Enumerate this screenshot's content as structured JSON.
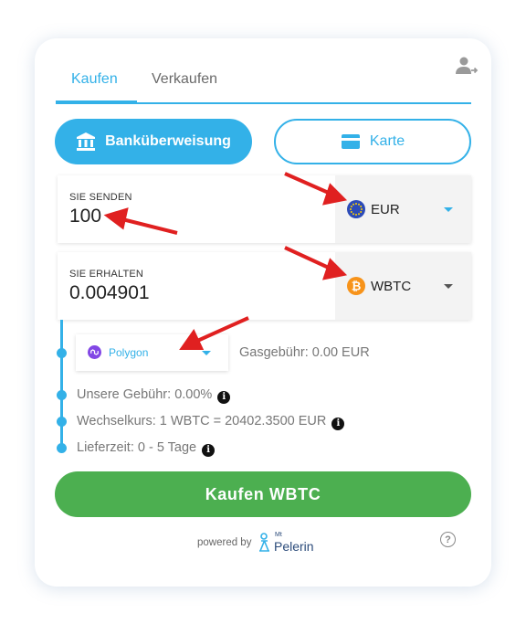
{
  "tabs": {
    "buy": "Kaufen",
    "sell": "Verkaufen"
  },
  "payment": {
    "bank_label": "Banküberweisung",
    "card_label": "Karte"
  },
  "send": {
    "label": "SIE SENDEN",
    "amount": "100",
    "currency": "EUR"
  },
  "receive": {
    "label": "SIE ERHALTEN",
    "amount": "0.004901",
    "currency": "WBTC",
    "currency_symbol": "₿"
  },
  "network": {
    "label": "Polygon",
    "gas_fee": "Gasgebühr: 0.00 EUR"
  },
  "details": {
    "fee": "Unsere Gebühr: 0.00%",
    "rate": "Wechselkurs: 1 WBTC = 20402.3500 EUR",
    "delivery": "Lieferzeit: 0 - 5 Tage",
    "info_glyph": "i"
  },
  "buy_button": "Kaufen WBTC",
  "footer": {
    "powered_by": "powered by",
    "logo_small": "Mt",
    "logo_name": "Pelerin",
    "help_glyph": "?"
  },
  "icons": [
    "user-add-icon",
    "bank-icon",
    "credit-card-icon",
    "eur-flag-icon",
    "bitcoin-icon",
    "polygon-icon",
    "info-icon",
    "help-icon"
  ],
  "colors": {
    "accent": "#33b1e8",
    "buy": "#4caf50",
    "bitcoin": "#f7931a",
    "polygon": "#8247e5",
    "eur": "#2c4bb8",
    "arrow": "#e02020"
  }
}
